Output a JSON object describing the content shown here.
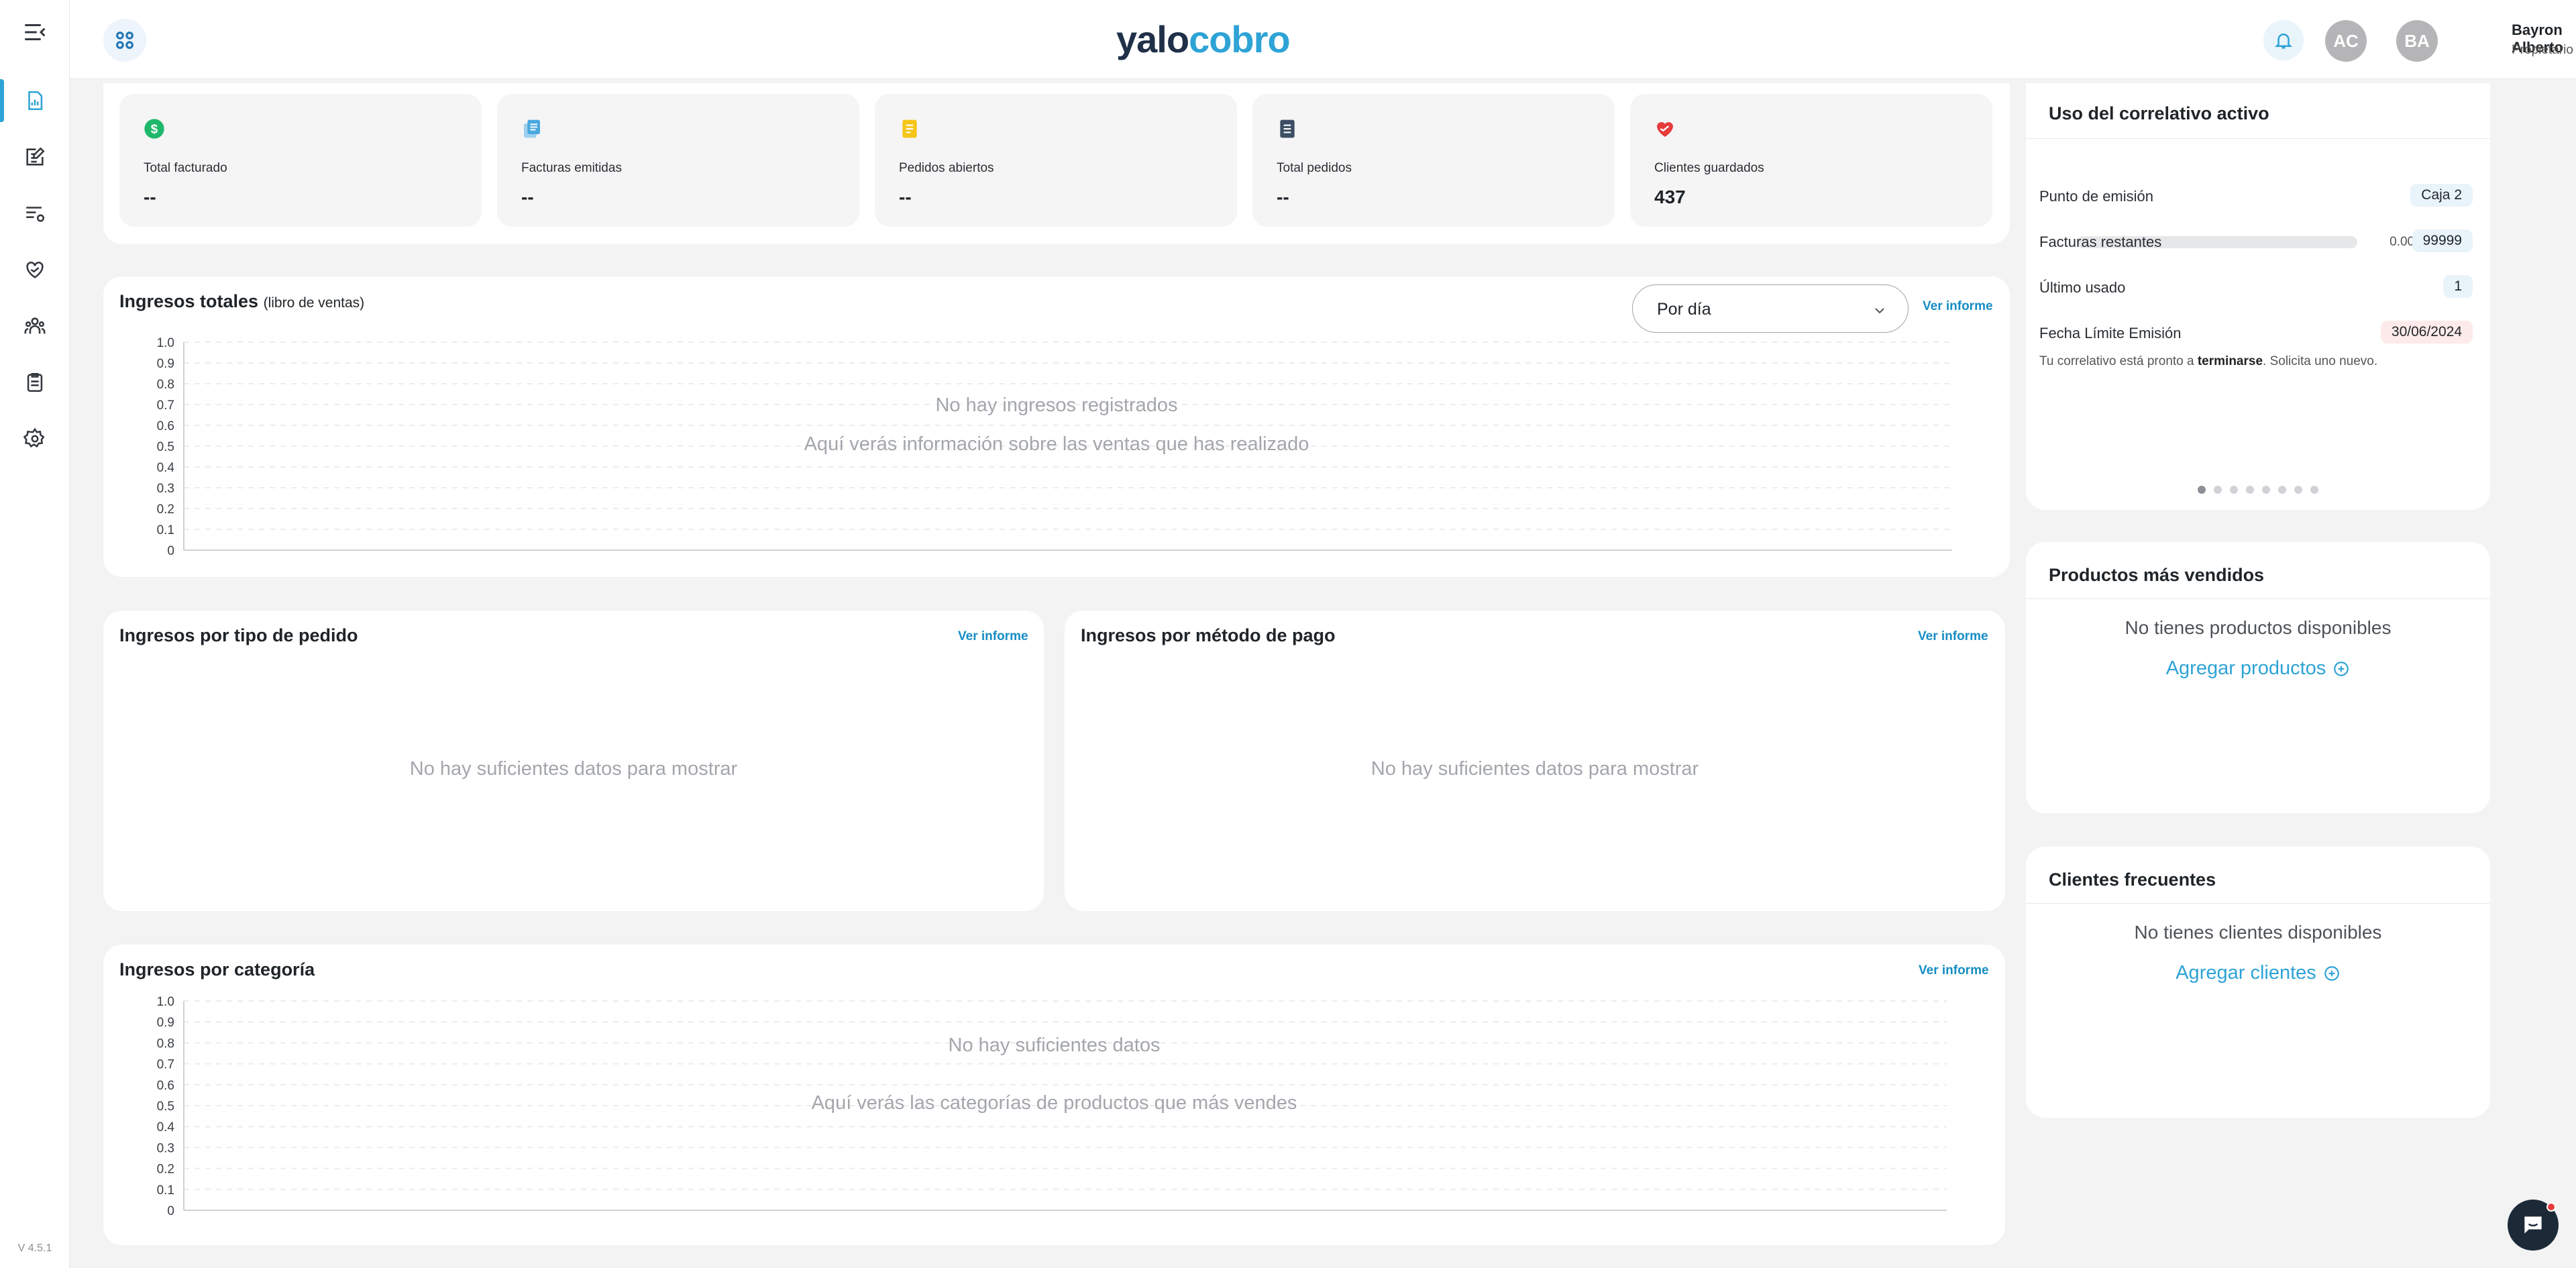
{
  "app": {
    "version": "V 4.5.1",
    "logo_part1": "yalo",
    "logo_part2": "cobro",
    "accent_color": "#2ea3d6"
  },
  "sidebar": {
    "toggle_icon": "menu-collapse-icon",
    "items": [
      {
        "icon": "chart-report-icon",
        "active": true
      },
      {
        "icon": "invoice-edit-icon",
        "active": false
      },
      {
        "icon": "list-settings-icon",
        "active": false
      },
      {
        "icon": "heart-hand-icon",
        "active": false
      },
      {
        "icon": "users-group-icon",
        "active": false
      },
      {
        "icon": "clipboard-icon",
        "active": false
      },
      {
        "icon": "gear-icon",
        "active": false
      }
    ]
  },
  "topbar": {
    "apps_icon": "grid-apps-icon",
    "bell_icon": "bell-icon",
    "avatar1_initials": "AC",
    "avatar2_initials": "BA",
    "user_name": "Bayron Alberto",
    "user_role": "Propietario"
  },
  "stats": [
    {
      "label": "Total facturado",
      "value": "--",
      "icon": "dollar-circle-icon",
      "color": "#1fb86b"
    },
    {
      "label": "Facturas emitidas",
      "value": "--",
      "icon": "copy-docs-icon",
      "color": "#4aa7e0"
    },
    {
      "label": "Pedidos abiertos",
      "value": "--",
      "icon": "note-icon",
      "color": "#f5c518"
    },
    {
      "label": "Total pedidos",
      "value": "--",
      "icon": "document-icon",
      "color": "#3c4e63"
    },
    {
      "label": "Clientes guardados",
      "value": "437",
      "icon": "heart-handshake-icon",
      "color": "#e53b3b"
    }
  ],
  "ingresos_totales": {
    "title": "Ingresos totales",
    "subtitle": "(libro de ventas)",
    "dropdown_value": "Por día",
    "link": "Ver informe",
    "empty_title": "No hay ingresos registrados",
    "empty_text": "Aquí verás información sobre las ventas que has realizado"
  },
  "tipo_pedido": {
    "title": "Ingresos por tipo de pedido",
    "link": "Ver informe",
    "empty_text": "No hay suficientes datos para mostrar"
  },
  "metodo_pago": {
    "title": "Ingresos por método de pago",
    "link": "Ver informe",
    "empty_text": "No hay suficientes datos para mostrar"
  },
  "categoria": {
    "title": "Ingresos por categoría",
    "link": "Ver informe",
    "empty_title": "No hay suficientes datos",
    "empty_text": "Aquí verás las categorías de productos que más vendes"
  },
  "correlativo": {
    "title": "Uso del correlativo activo",
    "percent": "0.00%",
    "progress": 0,
    "rows": [
      {
        "label": "Punto de emisión",
        "value": "Caja 2",
        "tone": "blue"
      },
      {
        "label": "Facturas restantes",
        "value": "99999",
        "tone": "blue"
      },
      {
        "label": "Último usado",
        "value": "1",
        "tone": "blue"
      },
      {
        "label": "Fecha Límite Emisión",
        "value": "30/06/2024",
        "tone": "pink"
      }
    ],
    "note_before": "Tu correlativo está pronto a ",
    "note_bold": "terminarse",
    "note_after": ". Solicita uno nuevo.",
    "dots": 8,
    "active_dot": 0
  },
  "productos": {
    "title": "Productos más vendidos",
    "empty_text": "No tienes productos disponibles",
    "link": "Agregar productos"
  },
  "clientes": {
    "title": "Clientes frecuentes",
    "empty_text": "No tienes clientes disponibles",
    "link": "Agregar clientes"
  },
  "chart_data": [
    {
      "type": "line",
      "title": "Ingresos totales (libro de ventas)",
      "x": [],
      "series": [],
      "yticks": [
        "0",
        "0.1",
        "0.2",
        "0.3",
        "0.4",
        "0.5",
        "0.6",
        "0.7",
        "0.8",
        "0.9",
        "1.0"
      ],
      "ylim": [
        0,
        1
      ],
      "grid": true
    },
    {
      "type": "bar",
      "title": "Ingresos por categoría",
      "categories": [],
      "values": [],
      "yticks": [
        "0",
        "0.1",
        "0.2",
        "0.3",
        "0.4",
        "0.5",
        "0.6",
        "0.7",
        "0.8",
        "0.9",
        "1.0"
      ],
      "ylim": [
        0,
        1
      ],
      "grid": true
    }
  ]
}
